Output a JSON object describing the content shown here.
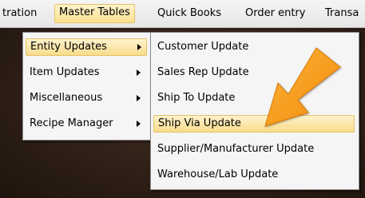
{
  "menubar": {
    "items": [
      {
        "label": "tration"
      },
      {
        "label": "Master Tables"
      },
      {
        "label": "Quick Books"
      },
      {
        "label": "Order entry"
      },
      {
        "label": "Transa"
      }
    ]
  },
  "master_tables_menu": {
    "items": [
      {
        "label": "Entity Updates",
        "submenu": true
      },
      {
        "label": "Item Updates",
        "submenu": true
      },
      {
        "label": "Miscellaneous",
        "submenu": true
      },
      {
        "label": "Recipe Manager",
        "submenu": true
      }
    ]
  },
  "entity_updates_menu": {
    "items": [
      {
        "label": "Customer Update"
      },
      {
        "label": "Sales Rep Update"
      },
      {
        "label": "Ship To Update"
      },
      {
        "label": "Ship Via Update"
      },
      {
        "label": "Supplier/Manufacturer Update"
      },
      {
        "label": "Warehouse/Lab Update"
      }
    ]
  },
  "annotation": {
    "arrow_color": "#f39a14",
    "highlight_color": "#f9df8e"
  }
}
